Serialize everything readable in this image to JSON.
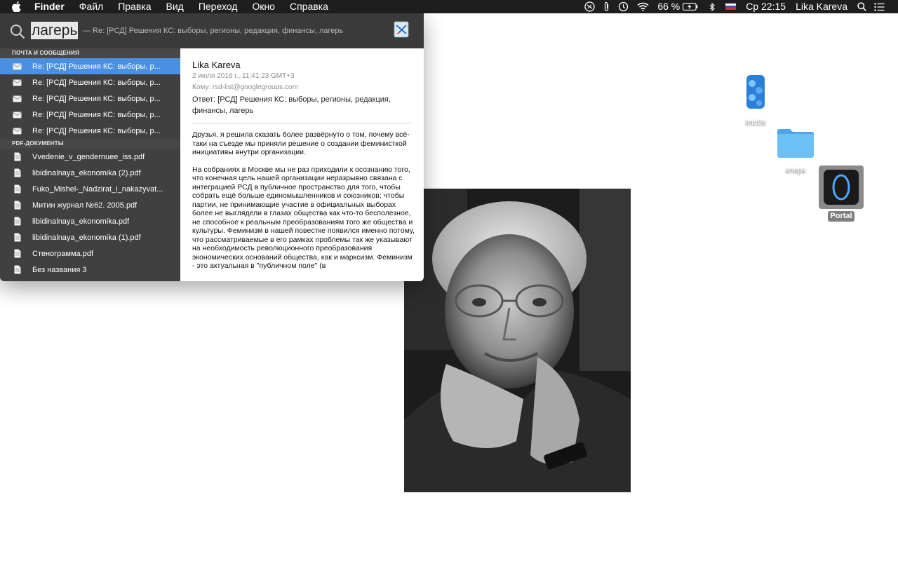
{
  "menubar": {
    "app_name": "Finder",
    "items": [
      "Файл",
      "Правка",
      "Вид",
      "Переход",
      "Окно",
      "Справка"
    ],
    "battery": "66 %",
    "clock": "Ср 22:15",
    "user": "Lika Kareva"
  },
  "spotlight": {
    "query": "лагерь",
    "hint": "— Re: [РСД] Решения КС: выборы, регионы, редакция, финансы, лагерь",
    "sections": {
      "mail_header": "ПОЧТА И СООБЩЕНИЯ",
      "pdf_header": "PDF-ДОКУМЕНТЫ"
    },
    "mail_results": [
      "Re: [РСД] Решения КС: выборы, р...",
      "Re: [РСД] Решения КС: выборы, р...",
      "Re: [РСД] Решения КС: выборы, р...",
      "Re: [РСД] Решения КС: выборы, р...",
      "Re: [РСД] Решения КС: выборы, р..."
    ],
    "pdf_results": [
      "Vvedenie_v_gendernuee_iss.pdf",
      "libidinalnaya_ekonomika (2).pdf",
      "Fuko_Mishel-_Nadzirat_i_nakazyvat...",
      "Митин журнал №62. 2005.pdf",
      "libidinalnaya_ekonomika.pdf",
      "libidinalnaya_ekonomika (1).pdf",
      "Стенограмма.pdf",
      "Без названия 3"
    ],
    "preview": {
      "from": "Lika Kareva",
      "date": "2 июля 2016 г., 11:41:23 GMT+3",
      "to": "Кому: rsd-list@googlegroups.com",
      "subject": "Ответ: [РСД] Решения КС: выборы, регионы, редакция, финансы, лагерь",
      "body_1": "Друзья, я решила сказать более развёрнуто о том, почему всё-таки на съезде мы приняли решение о создании феминисткой инициативы внутри организации.",
      "body_2": "На собраниях в Москве мы не раз приходили к осознанию того, что конечная цель нашей организации неразрывно связана с интеграцией РСД в публичное пространство для того, чтобы собрать ещё больше единомышленников и союзников; чтобы партии, не принимающие участие в официальных выборах более не выглядели в глазах общества как что-то бесполезное, не способное к реальным преобразованиям того же общества и культуры. Феминизм в нашей повестке появился именно потому, что рассматриваемые в его рамках проблемы так же указывают на необходимость революционного преобразования экономических оснований общества, как и марксизм. Феминизм - это актуальная в \"публичном поле\" (в"
    }
  },
  "desktop": {
    "icons": [
      {
        "label": "intc0s",
        "icon": "usb-drive-icon"
      },
      {
        "label": "клерк",
        "icon": "folder-icon"
      },
      {
        "label": "Portal",
        "icon": "portal-app-icon"
      }
    ]
  },
  "colors": {
    "menubar_bg": "#1e1e1e",
    "spotlight_list_bg": "#404040",
    "selection": "#4a90e2",
    "folder": "#5ab4f0"
  }
}
